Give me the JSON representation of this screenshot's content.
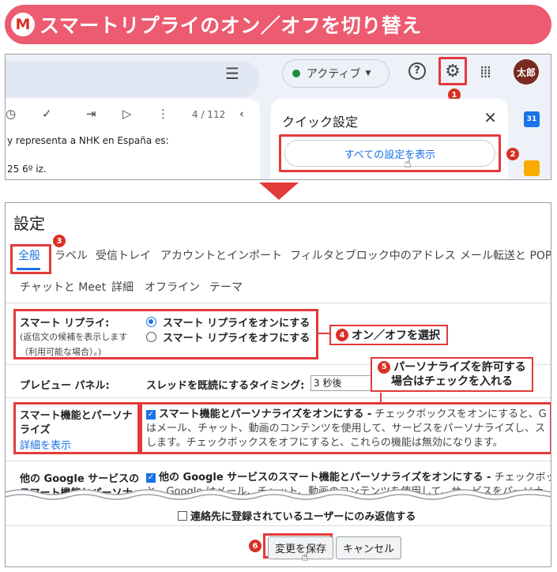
{
  "banner": {
    "logo": "M",
    "title": "スマートリプライのオン／オフを切り替え"
  },
  "top_bar": {
    "filter_icon": "tune-icon",
    "status": "アクティブ",
    "avatar": "太郎",
    "badge1": "1"
  },
  "mail_toolbar": {
    "pager": "4 / 112"
  },
  "mail_snippets": [
    "y representa a NHK en España es:",
    "25 6º iz."
  ],
  "quick_settings": {
    "title": "クイック設定",
    "show_all": "すべての設定を表示",
    "badge2": "2"
  },
  "settings": {
    "title": "設定",
    "tabs_row1": [
      "全般",
      "ラベル",
      "受信トレイ",
      "アカウントとインポート",
      "フィルタとブロック中のアドレス",
      "メール転送と POP/I"
    ],
    "tabs_row2": [
      "チャットと Meet",
      "詳細",
      "オフライン",
      "テーマ"
    ],
    "badge3": "3",
    "smart_reply": {
      "label": "スマート リプライ:",
      "note1": "(返信文の候補を表示します",
      "note2": "（利用可能な場合）。)",
      "option_on": "スマート リプライをオンにする",
      "option_off": "スマート リプライをオフにする"
    },
    "callout4": {
      "num": "4",
      "text": "オン／オフを選択"
    },
    "callout5": {
      "num": "5",
      "line1": "パーソナライズを許可する",
      "line2": "場合はチェックを入れる"
    },
    "preview": {
      "label": "プレビュー パネル:",
      "timing_label": "スレッドを既読にするタイミング:",
      "timing_value": "3 秒後"
    },
    "smart_features": {
      "label1": "スマート機能とパーソナ",
      "label2": "ライズ",
      "link": "詳細を表示",
      "check_label": "スマート機能とパーソナライズをオンにする -",
      "desc1": " チェックボックスをオンにすると、G",
      "desc2": "はメール、チャット、動画のコンテンツを使用して、サービスをパーソナライズし、ス",
      "desc3": "します。チェックボックスをオフにすると、これらの機能は無効になります。"
    },
    "other_google": {
      "label1": "他の Google サービスの",
      "label2": "スマート機能とパーソナ",
      "check_label": "他の Google サービスのスマート機能とパーソナライズをオンにする -",
      "desc1": " チェックボッ",
      "desc2": "と、Google はメール、チャット、動画のコンテンツを使用して、サービスをパーソナ"
    },
    "reply_only": "連絡先に登録されているユーザーにのみ返信する",
    "save": "変更を保存",
    "cancel": "キャンセル",
    "badge6": "6"
  }
}
